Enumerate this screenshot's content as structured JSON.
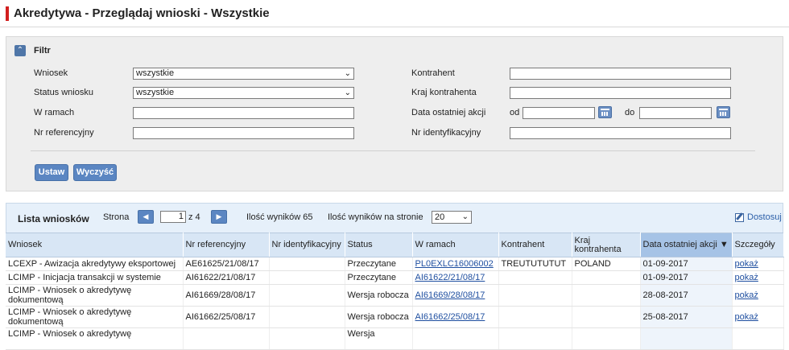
{
  "page": {
    "title": "Akredytywa - Przeglądaj wnioski - Wszystkie"
  },
  "filter": {
    "title": "Filtr",
    "collapse_icon": "double-chevron-up-icon",
    "fields": {
      "wniosek": {
        "label": "Wniosek",
        "value": "wszystkie"
      },
      "status": {
        "label": "Status wniosku",
        "value": "wszystkie"
      },
      "w_ramach": {
        "label": "W ramach",
        "value": ""
      },
      "nr_ref": {
        "label": "Nr referencyjny",
        "value": ""
      },
      "kontrahent": {
        "label": "Kontrahent",
        "value": ""
      },
      "kraj": {
        "label": "Kraj kontrahenta",
        "value": ""
      },
      "data_akcji": {
        "label": "Data ostatniej akcji",
        "od_label": "od",
        "do_label": "do",
        "od_value": "",
        "do_value": ""
      },
      "nr_ident": {
        "label": "Nr identyfikacyjny",
        "value": ""
      }
    },
    "buttons": {
      "ustaw": "Ustaw",
      "wyczysc": "Wyczyść"
    }
  },
  "list": {
    "title": "Lista wniosków",
    "strona_label": "Strona",
    "prev_icon": "arrow-left-icon",
    "next_icon": "arrow-right-icon",
    "page_value": "1",
    "page_of": "z 4",
    "results_count": "Ilość wyników 65",
    "per_page_label": "Ilość wyników na stronie",
    "per_page_value": "20",
    "customize": "Dostosuj",
    "columns": {
      "wniosek": "Wniosek",
      "nr_ref": "Nr referencyjny",
      "nr_ident": "Nr identyfikacyjny",
      "status": "Status",
      "w_ramach": "W ramach",
      "kontrahent": "Kontrahent",
      "kraj": "Kraj kontrahenta",
      "data": "Data ostatniej akcji ▼",
      "szczegoly": "Szczegóły"
    },
    "rows": [
      {
        "wniosek": "LCEXP - Awizacja akredytywy eksportowej",
        "nr_ref": "AE61625/21/08/17",
        "nr_ident": "",
        "status": "Przeczytane",
        "w_ramach": "PL0EXLC16006002",
        "kontrahent": "TREUTUTUTUT",
        "kraj": "POLAND",
        "data": "01-09-2017",
        "szczegoly": "pokaż"
      },
      {
        "wniosek": "LCIMP - Inicjacja transakcji w systemie",
        "nr_ref": "AI61622/21/08/17",
        "nr_ident": "",
        "status": "Przeczytane",
        "w_ramach": "AI61622/21/08/17",
        "kontrahent": "",
        "kraj": "",
        "data": "01-09-2017",
        "szczegoly": "pokaż"
      },
      {
        "wniosek": "LCIMP - Wniosek o akredytywę dokumentową",
        "nr_ref": "AI61669/28/08/17",
        "nr_ident": "",
        "status": "Wersja robocza",
        "w_ramach": "AI61669/28/08/17",
        "kontrahent": "",
        "kraj": "",
        "data": "28-08-2017",
        "szczegoly": "pokaż"
      },
      {
        "wniosek": "LCIMP - Wniosek o akredytywę dokumentową",
        "nr_ref": "AI61662/25/08/17",
        "nr_ident": "",
        "status": "Wersja robocza",
        "w_ramach": "AI61662/25/08/17",
        "kontrahent": "",
        "kraj": "",
        "data": "25-08-2017",
        "szczegoly": "pokaż"
      },
      {
        "wniosek": "LCIMP - Wniosek o akredytywę",
        "nr_ref": "",
        "nr_ident": "",
        "status": "Wersja",
        "w_ramach": "",
        "kontrahent": "",
        "kraj": "",
        "data": "",
        "szczegoly": ""
      }
    ]
  },
  "colors": {
    "accent_red": "#d21f1f",
    "button_blue": "#5b86c2",
    "link_blue": "#1f4fa0",
    "header_blue": "#d8e6f5"
  }
}
